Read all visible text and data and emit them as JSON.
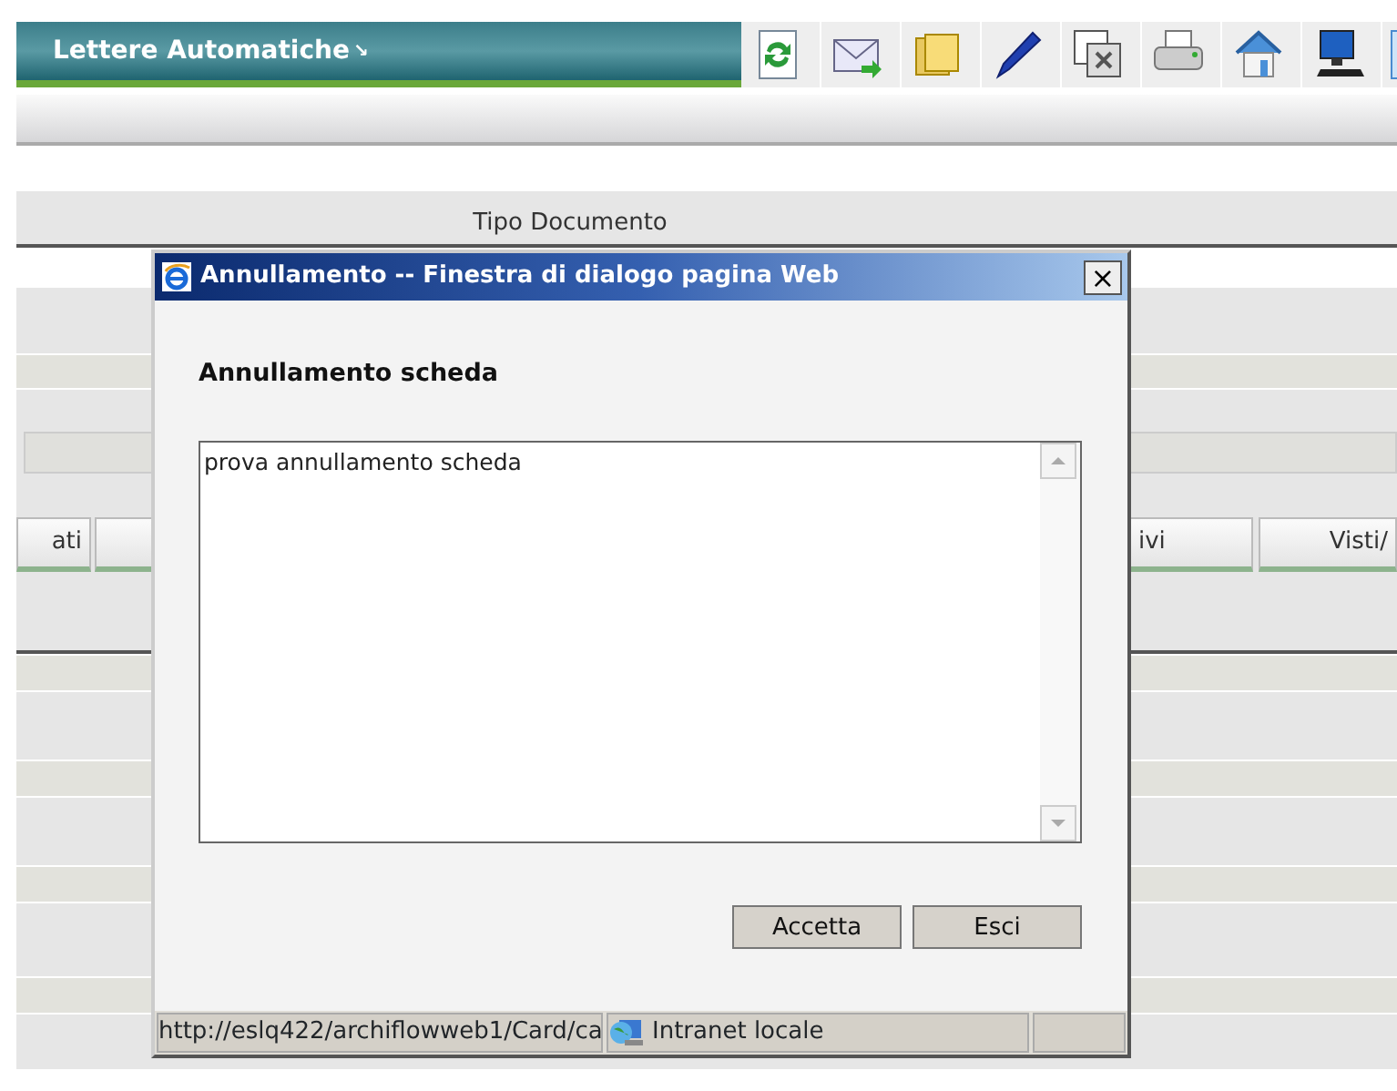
{
  "header": {
    "title": "Lettere Automatiche",
    "arrow": "↘"
  },
  "page": {
    "field_label": "Tipo Documento",
    "tabs": [
      {
        "label": "ati"
      },
      {
        "label": "ivi"
      },
      {
        "label": "Visti/"
      }
    ]
  },
  "dialog": {
    "title": "Annullamento -- Finestra di dialogo pagina Web",
    "close": "×",
    "heading": "Annullamento scheda",
    "text": "prova annullamento scheda",
    "buttons": [
      "Accetta",
      "Esci"
    ],
    "status_bar": {
      "url": "http://eslq422/archiflowweb1/Card/ca",
      "zone": "Intranet locale"
    }
  }
}
